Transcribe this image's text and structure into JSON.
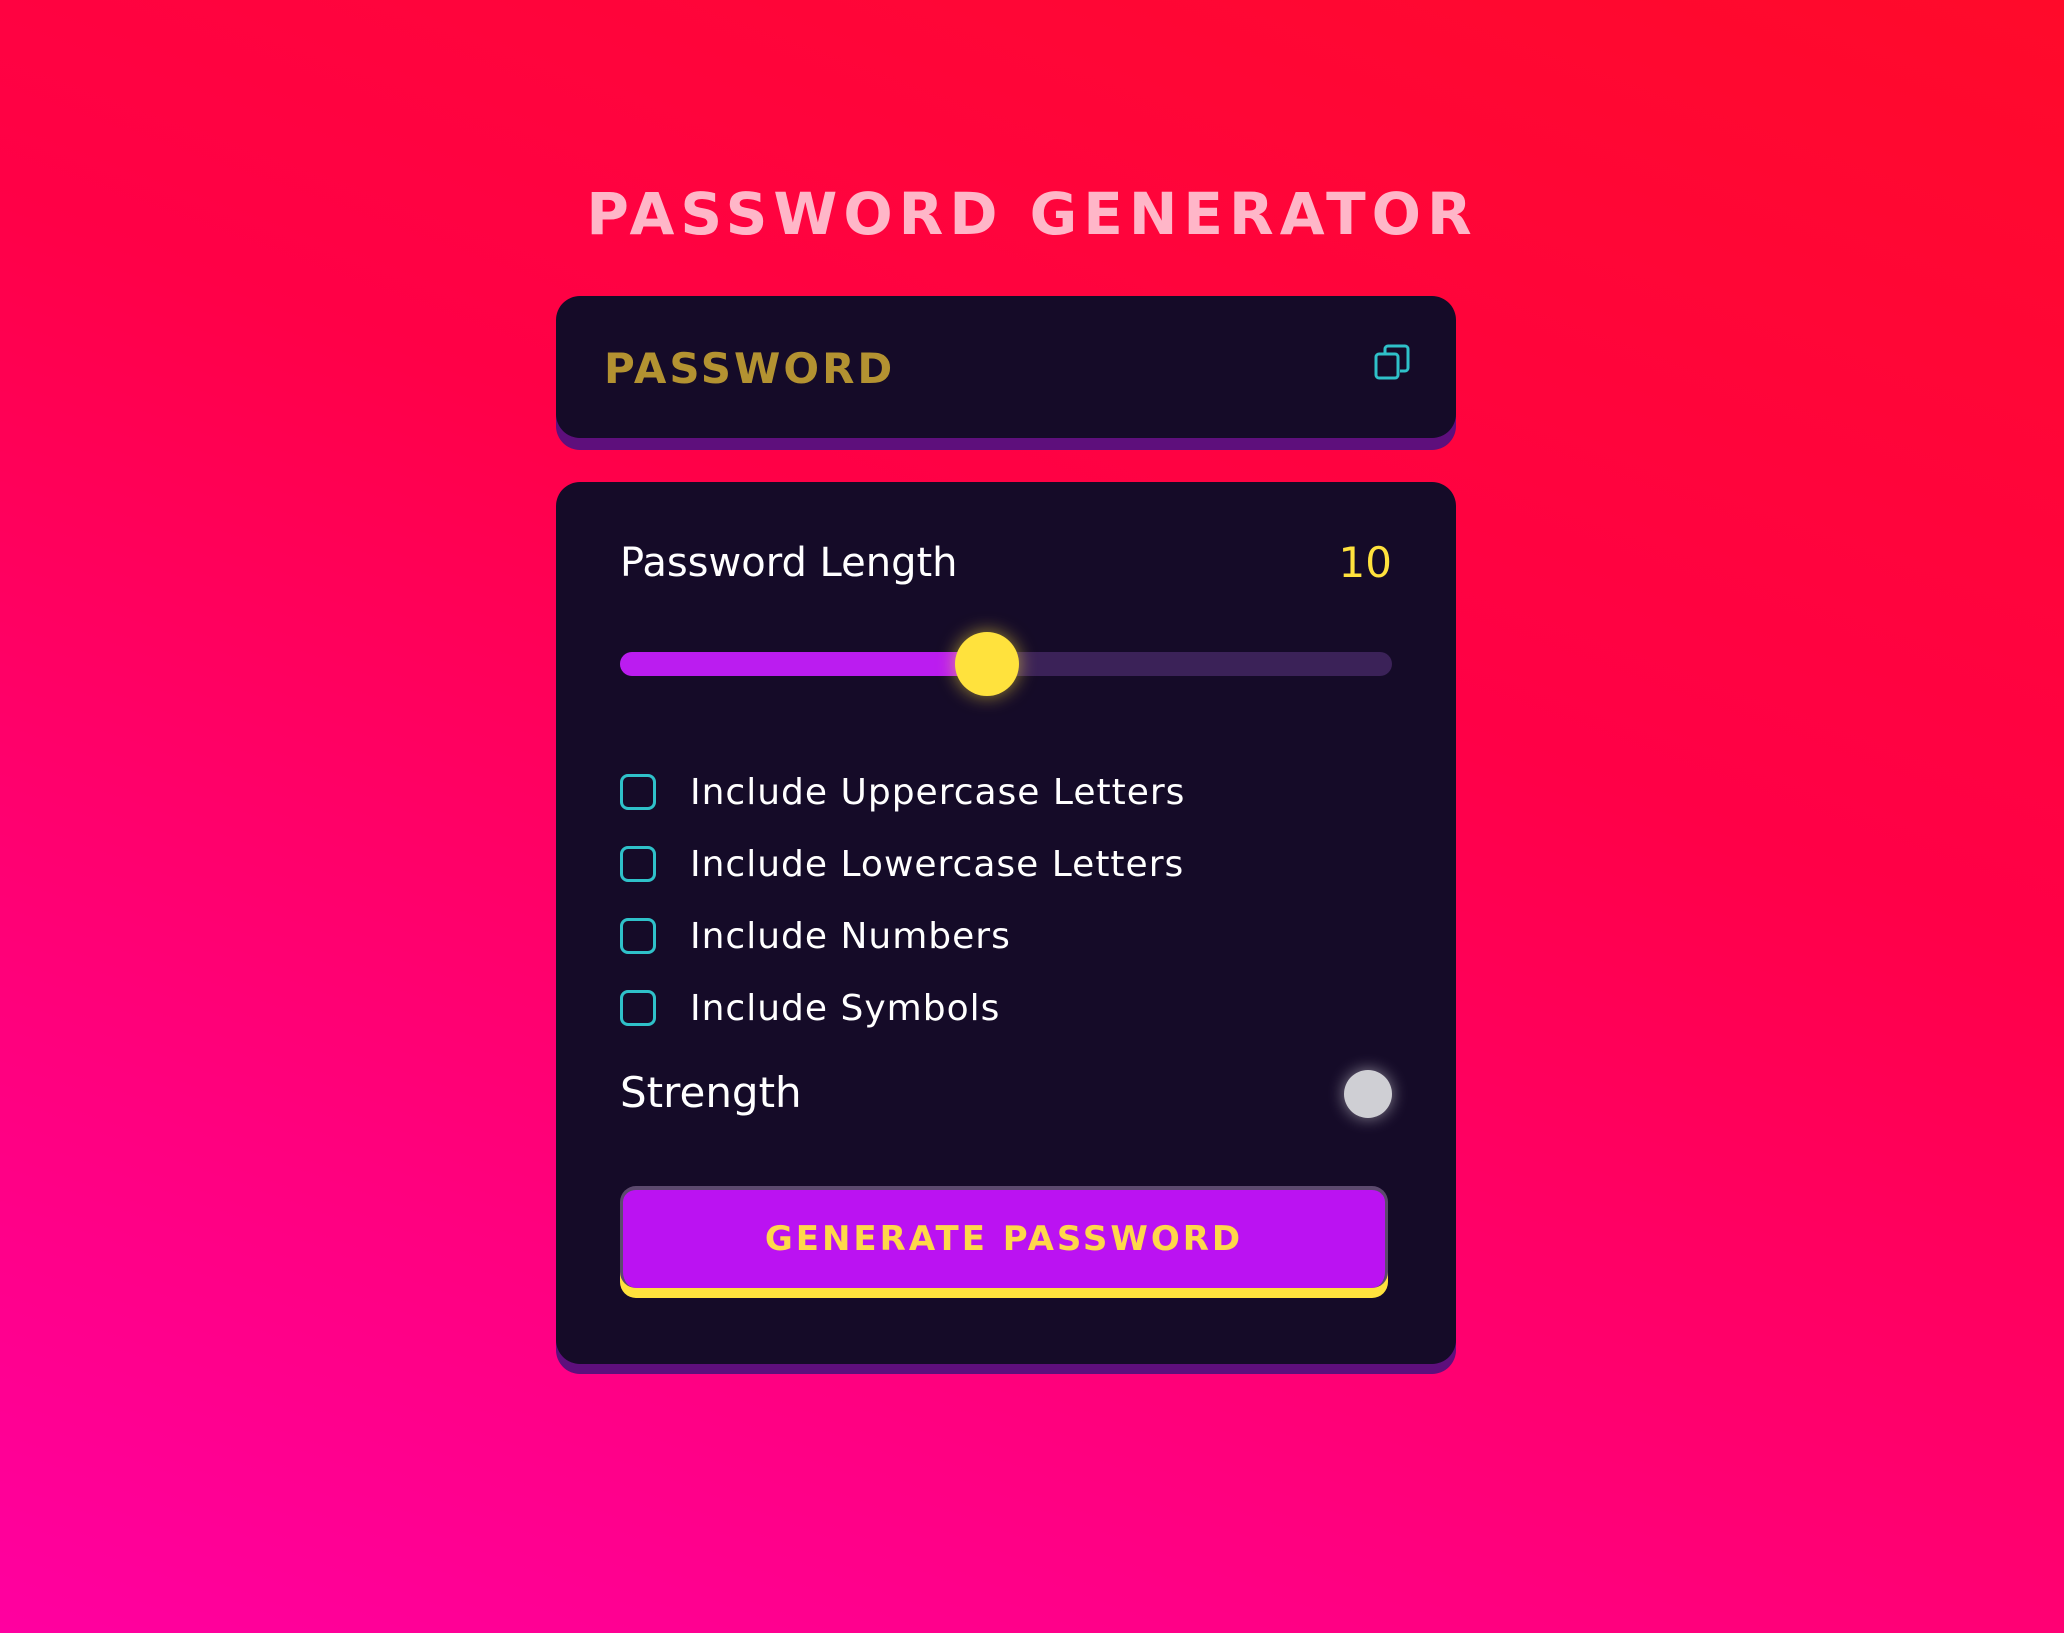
{
  "app": {
    "title": "PASSWORD GENERATOR"
  },
  "password_display": {
    "value": "PASSWORD",
    "copy_icon": "copy-icon"
  },
  "length": {
    "label": "Password Length",
    "value": "10",
    "slider_fraction": 0.475
  },
  "options": [
    {
      "label": "Include Uppercase Letters",
      "checked": false
    },
    {
      "label": "Include Lowercase Letters",
      "checked": false
    },
    {
      "label": "Include Numbers",
      "checked": false
    },
    {
      "label": "Include Symbols",
      "checked": false
    }
  ],
  "strength": {
    "label": "Strength"
  },
  "generate_button": {
    "label": "GENERATE PASSWORD"
  },
  "colors": {
    "accent_yellow": "#ffe23d",
    "accent_purple": "#bb12f2",
    "card_bg": "#150b28",
    "checkbox_teal": "#2fc1c9"
  }
}
